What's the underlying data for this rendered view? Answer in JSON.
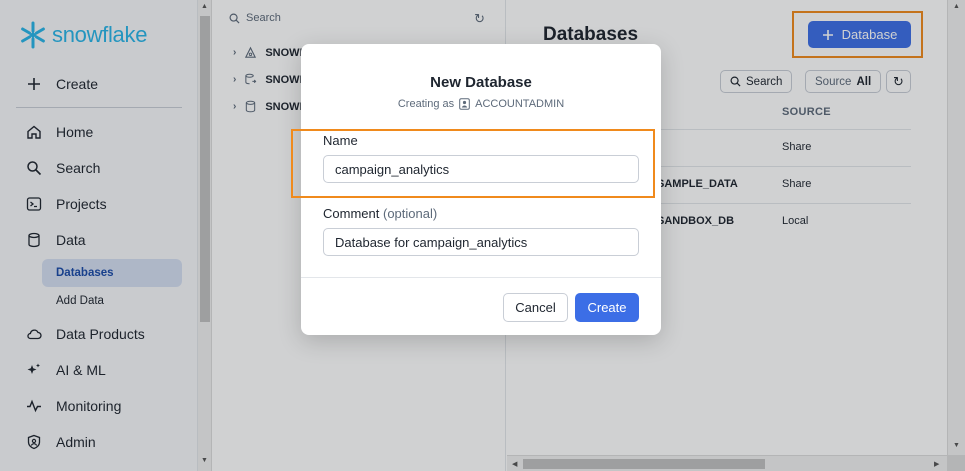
{
  "brand": {
    "name": "snowflake"
  },
  "sidebar": {
    "create_label": "Create",
    "items": [
      {
        "label": "Home",
        "icon": "home-icon"
      },
      {
        "label": "Search",
        "icon": "search-icon"
      },
      {
        "label": "Projects",
        "icon": "terminal-icon"
      },
      {
        "label": "Data",
        "icon": "database-icon"
      },
      {
        "label": "Data Products",
        "icon": "cloud-icon"
      },
      {
        "label": "AI & ML",
        "icon": "sparkle-icon"
      },
      {
        "label": "Monitoring",
        "icon": "activity-icon"
      },
      {
        "label": "Admin",
        "icon": "shield-icon"
      }
    ],
    "sub_items": [
      {
        "label": "Databases",
        "active": true
      },
      {
        "label": "Add Data",
        "active": false
      }
    ]
  },
  "tree": {
    "search_placeholder": "Search",
    "rows": [
      {
        "label": "SNOWF"
      },
      {
        "label": "SNOWF"
      },
      {
        "label": "SNOWF"
      }
    ]
  },
  "main": {
    "title": "Databases",
    "add_button_label": "Database",
    "search_label": "Search",
    "source_label": "Source",
    "source_value": "All",
    "column_source": "SOURCE",
    "rows": [
      {
        "name": "",
        "source": "Share"
      },
      {
        "name": "SAMPLE_DATA",
        "source": "Share"
      },
      {
        "name": "SANDBOX_DB",
        "source": "Local"
      }
    ]
  },
  "modal": {
    "title": "New Database",
    "subtitle_prefix": "Creating as",
    "role": "ACCOUNTADMIN",
    "name_label": "Name",
    "name_value": "campaign_analytics",
    "comment_label": "Comment",
    "comment_optional": "(optional)",
    "comment_value": "Database for campaign_analytics",
    "cancel_label": "Cancel",
    "create_label": "Create"
  },
  "colors": {
    "accent": "#3c6ee6",
    "brand": "#29b5e8",
    "highlight": "#f08a1c"
  }
}
